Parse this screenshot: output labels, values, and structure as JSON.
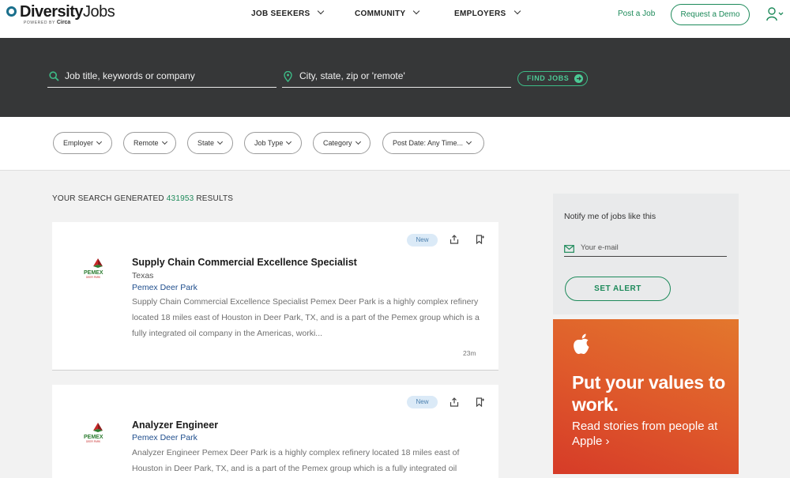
{
  "header": {
    "logo_main": "Diversity",
    "logo_light": "Jobs",
    "logo_powered": "POWERED BY",
    "logo_brand": "Circa",
    "nav": [
      "JOB SEEKERS",
      "COMMUNITY",
      "EMPLOYERS"
    ],
    "post_job": "Post a Job",
    "request_demo": "Request a Demo"
  },
  "search": {
    "keyword_placeholder": "Job title, keywords or company",
    "location_placeholder": "City, state, zip or 'remote'",
    "find_button": "FIND JOBS"
  },
  "filters": [
    "Employer",
    "Remote",
    "State",
    "Job Type",
    "Category",
    "Post Date: Any Time..."
  ],
  "results": {
    "prefix": "YOUR SEARCH GENERATED",
    "count": "431953",
    "suffix": "RESULTS"
  },
  "jobs": [
    {
      "badge": "New",
      "title": "Supply Chain Commercial Excellence Specialist",
      "location": "Texas",
      "company": "Pemex Deer Park",
      "logo_text": "PEMEX",
      "logo_sub": "DEER PARK",
      "description": "Supply Chain Commercial Excellence Specialist    Pemex Deer Park is a highly complex refinery located 18 miles east of Houston in Deer Park, TX, and is a part of the Pemex group which is a fully integrated oil company in the Americas, worki...",
      "time": "23m"
    },
    {
      "badge": "New",
      "title": "Analyzer Engineer",
      "location": "",
      "company": "Pemex Deer Park",
      "logo_text": "PEMEX",
      "logo_sub": "DEER PARK",
      "description": "Analyzer Engineer    Pemex Deer Park is a highly complex refinery located 18 miles east of Houston in Deer Park, TX, and is a part of the Pemex group which is a fully integrated oil",
      "time": ""
    }
  ],
  "alert": {
    "title": "Notify me of jobs like this",
    "email_placeholder": "Your e-mail",
    "button": "SET ALERT"
  },
  "ad": {
    "headline": "Put your values to work.",
    "subtext": "Read stories from people at Apple ›"
  },
  "colors": {
    "brand_green": "#1d8a5a",
    "search_band": "#363738",
    "link_blue": "#1e4d8c",
    "ad_orange": "#df5a2b"
  }
}
